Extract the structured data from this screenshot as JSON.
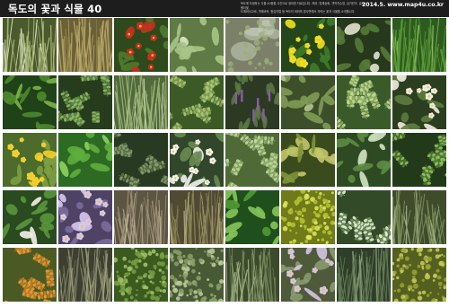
{
  "poster": {
    "title": "독도의 꽃과 식물 40",
    "date_url": "2014.5. www.map4u.co.kr",
    "description_lines": [
      "독도에 자생하는 식물 40종을 사진으로 정리한 자료입니다. 해국, 땅채송화, 갯까치수염, 섬기린초, 술패랭이꽃,",
      "도깨비쇠고비, 갯제비쑥, 왕김의털 등 독도의 바위와 경사면에서 자라는 꽃과 식물을 소개합니다."
    ]
  },
  "palette": {
    "title_bar": "#1d1d1d",
    "title_text": "#ffffff",
    "page": "#ffffff"
  },
  "tiles": [
    {
      "kind": "grass",
      "bg": "#4b5a2c",
      "fg": "#a9b978",
      "accent": "#dfe4c6"
    },
    {
      "kind": "grass",
      "bg": "#6b6137",
      "fg": "#b7a769",
      "accent": "#8d8447"
    },
    {
      "kind": "flowers",
      "bg": "#2e4a1d",
      "fg": "#4e7a2c",
      "accent": "#c7301f"
    },
    {
      "kind": "broad",
      "bg": "#5f7a45",
      "fg": "#a8c486",
      "accent": "#dbe8c4"
    },
    {
      "kind": "rock",
      "bg": "#7c8068",
      "fg": "#9eae7c",
      "accent": "#c9d2bd"
    },
    {
      "kind": "flowers",
      "bg": "#25461b",
      "fg": "#3f7b2a",
      "accent": "#f2e01e"
    },
    {
      "kind": "broad",
      "bg": "#27391c",
      "fg": "#557a3a",
      "accent": "#e3e3cf"
    },
    {
      "kind": "grass",
      "bg": "#2d5b1f",
      "fg": "#5a9a37",
      "accent": "#91c25a"
    },
    {
      "kind": "broad",
      "bg": "#1f4219",
      "fg": "#4f8a2d",
      "accent": "#7db447"
    },
    {
      "kind": "fern",
      "bg": "#263c1c",
      "fg": "#5b8b3c",
      "accent": "#98b771"
    },
    {
      "kind": "grass",
      "bg": "#506a3a",
      "fg": "#a0b77c",
      "accent": "#d1ddb8"
    },
    {
      "kind": "fern",
      "bg": "#3b5a25",
      "fg": "#7ea14f",
      "accent": "#b0c77e"
    },
    {
      "kind": "spikes",
      "bg": "#2c3a24",
      "fg": "#5d7b43",
      "accent": "#8b5aa3"
    },
    {
      "kind": "broad",
      "bg": "#3d4f2a",
      "fg": "#7f9b55",
      "accent": "#b4c58d"
    },
    {
      "kind": "fern",
      "bg": "#3b5a2a",
      "fg": "#88ad5b",
      "accent": "#c4d79c"
    },
    {
      "kind": "flowers",
      "bg": "#2b3f20",
      "fg": "#5d7c3c",
      "accent": "#f1ede1"
    },
    {
      "kind": "flowers",
      "bg": "#4c6b2c",
      "fg": "#7e9e43",
      "accent": "#f4d229"
    },
    {
      "kind": "broad",
      "bg": "#2d6a24",
      "fg": "#5fae3d",
      "accent": "#8ed262"
    },
    {
      "kind": "fern",
      "bg": "#293a22",
      "fg": "#566e44",
      "accent": "#8aa072"
    },
    {
      "kind": "flowers",
      "bg": "#31462a",
      "fg": "#6a8b52",
      "accent": "#f3f3f0"
    },
    {
      "kind": "fern",
      "bg": "#4f6a37",
      "fg": "#8fb06a",
      "accent": "#c3d8a2"
    },
    {
      "kind": "broad",
      "bg": "#3a4b1e",
      "fg": "#7f9439",
      "accent": "#c3c769"
    },
    {
      "kind": "broad",
      "bg": "#2d4a22",
      "fg": "#5d8c43",
      "accent": "#d1e3c3"
    },
    {
      "kind": "fern",
      "bg": "#233a1a",
      "fg": "#4d7a30",
      "accent": "#93c063"
    },
    {
      "kind": "broad",
      "bg": "#2a4a20",
      "fg": "#59963b",
      "accent": "#f5f1e8"
    },
    {
      "kind": "flowers",
      "bg": "#4e4364",
      "fg": "#7b6c9a",
      "accent": "#d8c8ec"
    },
    {
      "kind": "grass",
      "bg": "#5c5542",
      "fg": "#9e9275",
      "accent": "#c9bfa5"
    },
    {
      "kind": "grass",
      "bg": "#4f4a31",
      "fg": "#8c8458",
      "accent": "#b4aa7c"
    },
    {
      "kind": "broad",
      "bg": "#1f4f1c",
      "fg": "#4f9a34",
      "accent": "#86c45a"
    },
    {
      "kind": "bush",
      "bg": "#6f7a1a",
      "fg": "#b6c430",
      "accent": "#e2e95e"
    },
    {
      "kind": "fern",
      "bg": "#324a27",
      "fg": "#6c8f57",
      "accent": "#e8eddf"
    },
    {
      "kind": "grass",
      "bg": "#3e4c2c",
      "fg": "#7c8f5c",
      "accent": "#aab88d"
    },
    {
      "kind": "fern",
      "bg": "#4b5a25",
      "fg": "#c77a1e",
      "accent": "#e0a23c"
    },
    {
      "kind": "grass",
      "bg": "#3d4031",
      "fg": "#7e8060",
      "accent": "#a6a682"
    },
    {
      "kind": "bush",
      "bg": "#3b5a20",
      "fg": "#79a043",
      "accent": "#a6c56b"
    },
    {
      "kind": "bush",
      "bg": "#475a34",
      "fg": "#8ba06a",
      "accent": "#c0ce9f"
    },
    {
      "kind": "grass",
      "bg": "#3a4a2a",
      "fg": "#72855a",
      "accent": "#a5b387"
    },
    {
      "kind": "flowers",
      "bg": "#4e5a3a",
      "fg": "#8a9a70",
      "accent": "#d6c4e6"
    },
    {
      "kind": "grass",
      "bg": "#2f3e29",
      "fg": "#627a53",
      "accent": "#93a884"
    },
    {
      "kind": "bush",
      "bg": "#556020",
      "fg": "#9aa534",
      "accent": "#c8cf5e"
    }
  ]
}
